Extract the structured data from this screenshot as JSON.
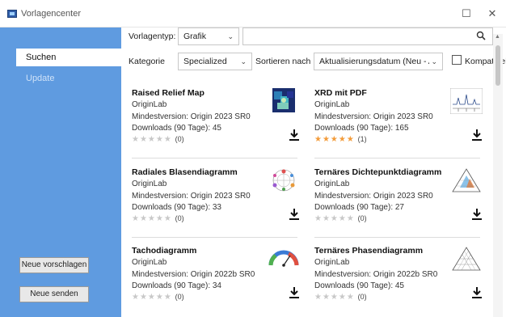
{
  "window": {
    "title": "Vorlagencenter",
    "minimize_glyph": "☐",
    "close_glyph": "✕"
  },
  "sidebar": {
    "tabs": [
      {
        "label": "Suchen",
        "active": true
      },
      {
        "label": "Update",
        "active": false
      }
    ],
    "buttons": [
      {
        "label": "Neue vorschlagen"
      },
      {
        "label": "Neue senden"
      }
    ]
  },
  "filters": {
    "template_type_label": "Vorlagentyp:",
    "template_type_value": "Grafik",
    "search_placeholder": "",
    "category_label": "Kategorie",
    "category_value": "Specialized",
    "sort_label": "Sortieren nach",
    "sort_value": "Aktualisierungsdatum (Neu - A",
    "compatible_label": "Kompatibel",
    "compatible_checked": false
  },
  "cards": [
    {
      "title": "Raised Relief Map",
      "publisher": "OriginLab",
      "min_version": "Mindestversion: Origin 2023 SR0",
      "downloads": "Downloads (90 Tage): 45",
      "rating_stars": 0,
      "rating_count": "(0)",
      "thumb": "relief-map"
    },
    {
      "title": "XRD mit PDF",
      "publisher": "OriginLab",
      "min_version": "Mindestversion: Origin 2023 SR0",
      "downloads": "Downloads (90 Tage): 165",
      "rating_stars": 5,
      "rating_count": "(1)",
      "thumb": "xrd-plot"
    },
    {
      "title": "Radiales Blasendiagramm",
      "publisher": "OriginLab",
      "min_version": "Mindestversion: Origin 2023 SR0",
      "downloads": "Downloads (90 Tage): 33",
      "rating_stars": 0,
      "rating_count": "(0)",
      "thumb": "radial-bubble"
    },
    {
      "title": "Ternäres Dichtepunktdiagramm",
      "publisher": "OriginLab",
      "min_version": "Mindestversion: Origin 2023 SR0",
      "downloads": "Downloads (90 Tage): 27",
      "rating_stars": 0,
      "rating_count": "(0)",
      "thumb": "ternary-density"
    },
    {
      "title": "Tachodiagramm",
      "publisher": "OriginLab",
      "min_version": "Mindestversion: Origin 2022b SR0",
      "downloads": "Downloads (90 Tage): 34",
      "rating_stars": 0,
      "rating_count": "(0)",
      "thumb": "gauge"
    },
    {
      "title": "Ternäres Phasendiagramm",
      "publisher": "OriginLab",
      "min_version": "Mindestversion: Origin 2022b SR0",
      "downloads": "Downloads (90 Tage): 45",
      "rating_stars": 0,
      "rating_count": "(0)",
      "thumb": "ternary-phase"
    }
  ],
  "colors": {
    "sidebar": "#5f9be0",
    "star_on": "#f39c3b",
    "star_off": "#c8c8c8"
  }
}
